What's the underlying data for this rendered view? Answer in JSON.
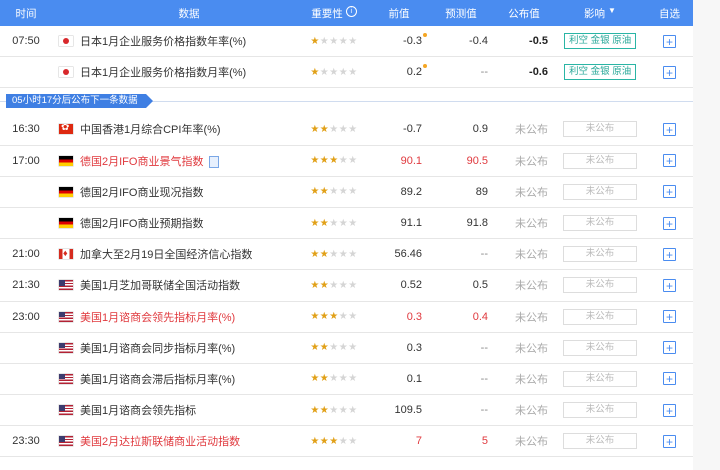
{
  "header": {
    "time": "时间",
    "data": "数据",
    "importance": "重要性",
    "previous": "前值",
    "forecast": "预测值",
    "actual": "公布值",
    "effect": "影响",
    "effect_arrow": "▼",
    "favorite": "自选",
    "info_glyph": "i"
  },
  "banner": "05小时17分后公布下一条数据",
  "plus_glyph": "+",
  "colors": {
    "header_bg": "#4a8cf0",
    "red_text": "#e0393e",
    "star_on": "#e1a017",
    "effect_tag": "#27a798"
  },
  "rows_top": [
    {
      "time": "07:50",
      "flag": "japan-flag-icon",
      "name": "日本1月企业服务价格指数年率(%)",
      "stars": 1,
      "previous": "-0.3",
      "forecast": "-0.4",
      "actual": "-0.5",
      "effect": "利空 金银 原油",
      "dot": true
    },
    {
      "time": "",
      "flag": "japan-flag-icon",
      "name": "日本1月企业服务价格指数月率(%)",
      "stars": 1,
      "previous": "0.2",
      "forecast": "--",
      "actual": "-0.6",
      "effect": "利空 金银 原油",
      "dot": true
    }
  ],
  "rows_bottom": [
    {
      "time": "16:30",
      "flag": "hongkong-flag-icon",
      "name": "中国香港1月综合CPI年率(%)",
      "stars": 2,
      "previous": "-0.7",
      "forecast": "0.9",
      "actual": "未公布",
      "effect": "未公布",
      "red": false
    },
    {
      "time": "17:00",
      "flag": "germany-flag-icon",
      "name": "德国2月IFO商业景气指数",
      "stars": 3,
      "previous": "90.1",
      "forecast": "90.5",
      "actual": "未公布",
      "effect": "未公布",
      "red": true,
      "doc": true
    },
    {
      "time": "",
      "flag": "germany-flag-icon",
      "name": "德国2月IFO商业现况指数",
      "stars": 2,
      "previous": "89.2",
      "forecast": "89",
      "actual": "未公布",
      "effect": "未公布",
      "red": false
    },
    {
      "time": "",
      "flag": "germany-flag-icon",
      "name": "德国2月IFO商业预期指数",
      "stars": 2,
      "previous": "91.1",
      "forecast": "91.8",
      "actual": "未公布",
      "effect": "未公布",
      "red": false
    },
    {
      "time": "21:00",
      "flag": "canada-flag-icon",
      "name": "加拿大至2月19日全国经济信心指数",
      "stars": 2,
      "previous": "56.46",
      "forecast": "--",
      "actual": "未公布",
      "effect": "未公布",
      "red": false
    },
    {
      "time": "21:30",
      "flag": "usa-flag-icon",
      "name": "美国1月芝加哥联储全国活动指数",
      "stars": 2,
      "previous": "0.52",
      "forecast": "0.5",
      "actual": "未公布",
      "effect": "未公布",
      "red": false
    },
    {
      "time": "23:00",
      "flag": "usa-flag-icon",
      "name": "美国1月谘商会领先指标月率(%)",
      "stars": 3,
      "previous": "0.3",
      "forecast": "0.4",
      "actual": "未公布",
      "effect": "未公布",
      "red": true
    },
    {
      "time": "",
      "flag": "usa-flag-icon",
      "name": "美国1月谘商会同步指标月率(%)",
      "stars": 2,
      "previous": "0.3",
      "forecast": "--",
      "actual": "未公布",
      "effect": "未公布",
      "red": false
    },
    {
      "time": "",
      "flag": "usa-flag-icon",
      "name": "美国1月谘商会滞后指标月率(%)",
      "stars": 2,
      "previous": "0.1",
      "forecast": "--",
      "actual": "未公布",
      "effect": "未公布",
      "red": false
    },
    {
      "time": "",
      "flag": "usa-flag-icon",
      "name": "美国1月谘商会领先指标",
      "stars": 2,
      "previous": "109.5",
      "forecast": "--",
      "actual": "未公布",
      "effect": "未公布",
      "red": false
    },
    {
      "time": "23:30",
      "flag": "usa-flag-icon",
      "name": "美国2月达拉斯联储商业活动指数",
      "stars": 3,
      "previous": "7",
      "forecast": "5",
      "actual": "未公布",
      "effect": "未公布",
      "red": true
    }
  ]
}
